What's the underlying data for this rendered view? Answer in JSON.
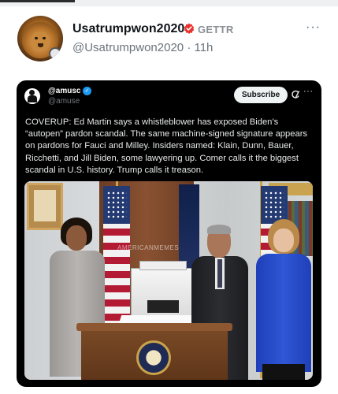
{
  "post": {
    "display_name": "Usatrumpwon2020",
    "platform": "GETTR",
    "handle": "@Usatrumpwon2020",
    "separator": "·",
    "time": "11h",
    "more": "···"
  },
  "embed": {
    "display_name": "@amusc",
    "handle": "@amuse",
    "subscribe_label": "Subscribe",
    "more": "···",
    "verified_glyph": "✓",
    "text": "COVERUP: Ed Martin says a whistleblower has exposed Biden’s “autopen” pardon scandal. The same machine-signed signature appears on pardons for Fauci and Milley. Insiders named: Klain, Dunn, Bauer, Ricchetti, and Jill Biden, some lawyering up. Comer calls it the biggest scandal in U.S. history. Trump calls it treason.",
    "photo_watermark": "AMERICANMEMES"
  },
  "icons": {
    "badge": "red-verified-badge-icon",
    "verified": "blue-verified-check-icon",
    "grok": "grok-icon",
    "more": "more-dots-icon"
  },
  "colors": {
    "badge_red": "#e8342f",
    "verified_blue": "#1d9bf0",
    "card_bg": "#000000"
  }
}
